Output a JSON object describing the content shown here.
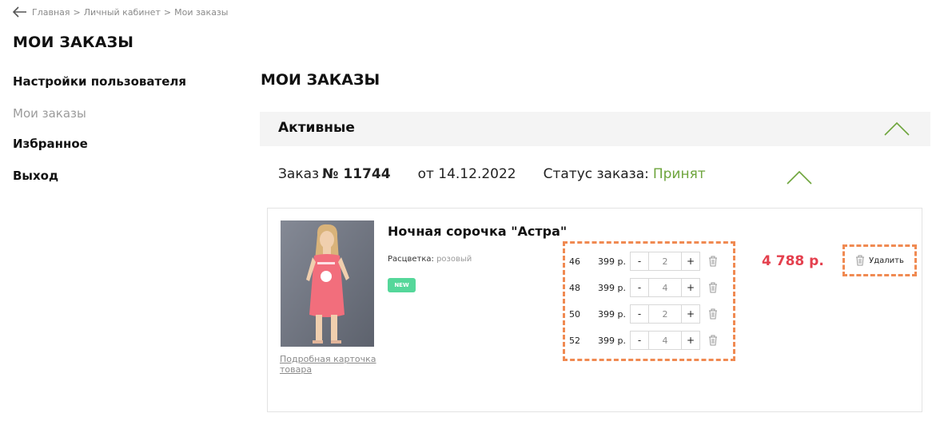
{
  "breadcrumb": {
    "back_icon": "arrow-left-icon",
    "items": [
      "Главная",
      "Личный кабинет",
      "Мои заказы"
    ],
    "separator": ">"
  },
  "page_title": "МОИ ЗАКАЗЫ",
  "sidebar": {
    "items": [
      {
        "label": "Настройки пользователя",
        "active": true
      },
      {
        "label": "Мои заказы",
        "active": false
      },
      {
        "label": "Избранное",
        "active": true
      },
      {
        "label": "Выход",
        "active": true
      }
    ]
  },
  "main": {
    "title": "МОИ ЗАКАЗЫ",
    "section": {
      "label": "Активные",
      "icon": "chevron-up-icon"
    },
    "order": {
      "prefix": "Заказ",
      "number": "№ 11744",
      "date": "от 14.12.2022",
      "status_label": "Статус заказа:",
      "status_value": "Принят",
      "status_color": "#6ea53c",
      "icon": "chevron-up-icon"
    },
    "product": {
      "name": "Ночная сорочка \"Астра\"",
      "color_label": "Расцветка:",
      "color_value": "розовый",
      "badge": "NEW",
      "detail_link": "Подробная карточка товара",
      "sizes": [
        {
          "size": "46",
          "price": "399 р.",
          "qty": "2",
          "minus": "-",
          "plus": "+"
        },
        {
          "size": "48",
          "price": "399 р.",
          "qty": "4",
          "minus": "-",
          "plus": "+"
        },
        {
          "size": "50",
          "price": "399 р.",
          "qty": "2",
          "minus": "-",
          "plus": "+"
        },
        {
          "size": "52",
          "price": "399 р.",
          "qty": "4",
          "minus": "-",
          "plus": "+"
        }
      ],
      "total": "4 788 р.",
      "total_color": "#e4404e",
      "delete_label": "Удалить"
    }
  },
  "colors": {
    "accent_green": "#6ea53c",
    "badge_green": "#55d79a",
    "highlight_orange": "#f08a52"
  }
}
